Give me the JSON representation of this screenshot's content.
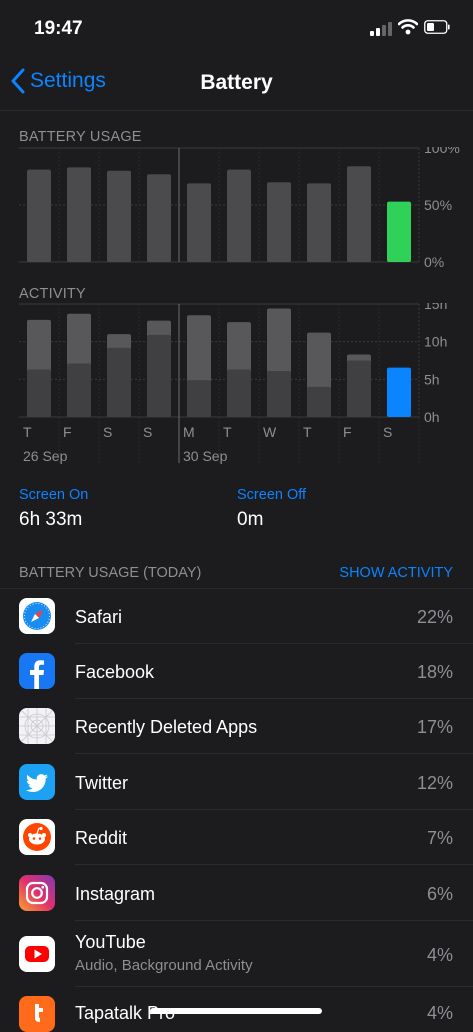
{
  "status_bar": {
    "time": "19:47"
  },
  "nav": {
    "back_label": "Settings",
    "title": "Battery"
  },
  "battery_section": {
    "label": "BATTERY USAGE"
  },
  "activity_section": {
    "label": "ACTIVITY"
  },
  "chart_data": [
    {
      "type": "bar",
      "title": "BATTERY USAGE",
      "categories": [
        "T",
        "F",
        "S",
        "S",
        "M",
        "T",
        "W",
        "T",
        "F",
        "S"
      ],
      "values": [
        81,
        83,
        80,
        77,
        69,
        81,
        70,
        69,
        84,
        53
      ],
      "yticks": [
        "100%",
        "50%",
        "0%"
      ],
      "ylim": [
        0,
        100
      ],
      "colors": {
        "bar": "#4b4b4e",
        "selected": "#30d158"
      },
      "selected_index": 9
    },
    {
      "type": "bar",
      "title": "ACTIVITY",
      "categories": [
        "T",
        "F",
        "S",
        "S",
        "M",
        "T",
        "W",
        "T",
        "F",
        "S"
      ],
      "series": [
        {
          "name": "Screen On",
          "values": [
            6.3,
            7.1,
            9.2,
            10.9,
            4.9,
            6.3,
            6.1,
            4.0,
            7.5,
            6.55
          ]
        },
        {
          "name": "Screen Off",
          "values": [
            6.6,
            6.6,
            1.8,
            1.9,
            8.6,
            6.3,
            8.3,
            7.2,
            0.8,
            0
          ]
        }
      ],
      "yticks": [
        "15h",
        "10h",
        "5h",
        "0h"
      ],
      "ylim": [
        0,
        15
      ],
      "colors": {
        "screen_on": "#404043",
        "screen_off": "#58585b",
        "selected": "#0a84ff"
      },
      "selected_index": 9,
      "date_labels": [
        "26 Sep",
        "30 Sep"
      ]
    }
  ],
  "stats": {
    "screen_on_label": "Screen On",
    "screen_on_value": "6h 33m",
    "screen_off_label": "Screen Off",
    "screen_off_value": "0m"
  },
  "list": {
    "header": "BATTERY USAGE (TODAY)",
    "action": "SHOW ACTIVITY",
    "items": [
      {
        "name": "Safari",
        "percent": "22%",
        "icon": "safari-icon"
      },
      {
        "name": "Facebook",
        "percent": "18%",
        "icon": "facebook-icon"
      },
      {
        "name": "Recently Deleted Apps",
        "percent": "17%",
        "icon": "deleted-apps-icon"
      },
      {
        "name": "Twitter",
        "percent": "12%",
        "icon": "twitter-icon"
      },
      {
        "name": "Reddit",
        "percent": "7%",
        "icon": "reddit-icon"
      },
      {
        "name": "Instagram",
        "percent": "6%",
        "icon": "instagram-icon"
      },
      {
        "name": "YouTube",
        "subtitle": "Audio, Background Activity",
        "percent": "4%",
        "icon": "youtube-icon"
      },
      {
        "name": "Tapatalk Pro",
        "percent": "4%",
        "icon": "tapatalk-icon"
      }
    ]
  }
}
